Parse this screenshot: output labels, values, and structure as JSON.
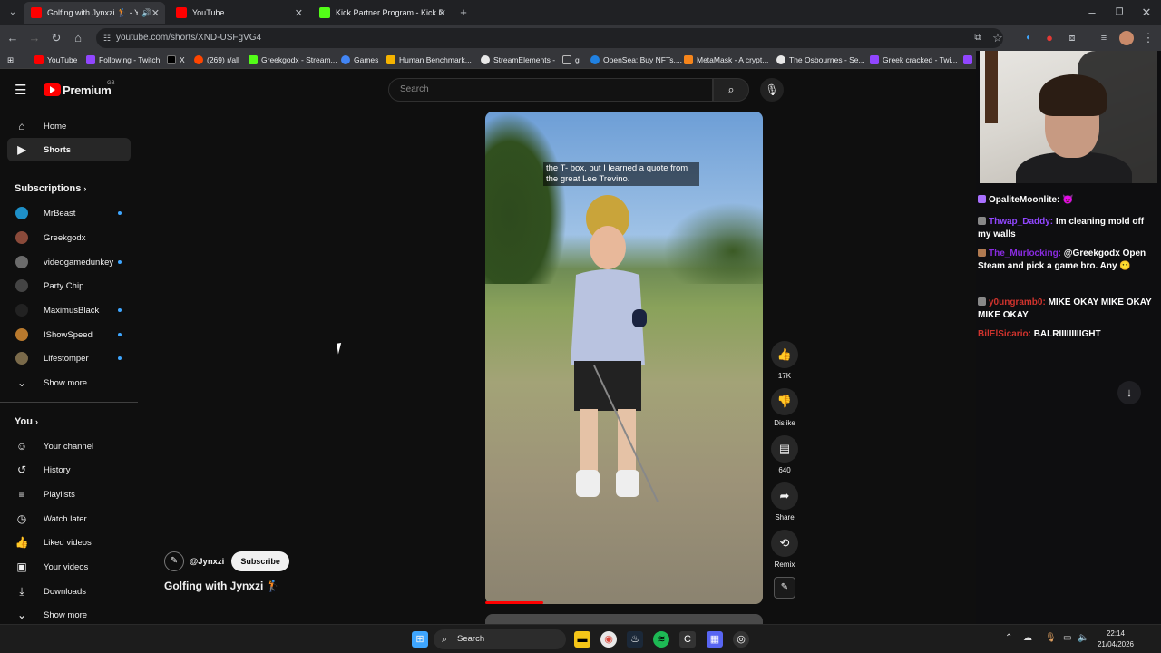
{
  "tabs": [
    {
      "title": "Golfing with Jynxzi 🏌 - Yo",
      "active": true,
      "icon": "youtube-icon"
    },
    {
      "title": "YouTube",
      "active": false,
      "icon": "youtube-icon"
    },
    {
      "title": "Kick Partner Program - Kick Da",
      "active": false,
      "icon": "kick-icon"
    }
  ],
  "browser": {
    "url": "youtube.com/shorts/XND-USFgVG4",
    "new_tab": "+",
    "bookmarks": [
      "YouTube",
      "Following - Twitch",
      "X",
      "(269) r/all",
      "Greekgodx - Stream...",
      "Games",
      "Human Benchmark...",
      "StreamElements -",
      "g",
      "OpenSea: Buy NFTs,...",
      "MetaMask - A crypt...",
      "The Osbournes - Se...",
      "Greek cracked - Twi...",
      "D"
    ]
  },
  "youtube": {
    "logo": "Premium",
    "logo_region": "GB",
    "search_placeholder": "Search",
    "nav": [
      {
        "label": "Home",
        "icon": "home-icon"
      },
      {
        "label": "Shorts",
        "icon": "shorts-icon",
        "active": true
      }
    ],
    "subscriptions_title": "Subscriptions",
    "subscriptions": [
      {
        "name": "MrBeast",
        "dot": true,
        "color": "#1e90c8"
      },
      {
        "name": "Greekgodx",
        "dot": false,
        "color": "#8a4a3a"
      },
      {
        "name": "videogamedunkey",
        "dot": true,
        "color": "#6b6b6b"
      },
      {
        "name": "Party Chip",
        "dot": false,
        "color": "#444444"
      },
      {
        "name": "MaximusBlack",
        "dot": true,
        "color": "#222222"
      },
      {
        "name": "IShowSpeed",
        "dot": true,
        "color": "#b8792d"
      },
      {
        "name": "Lifestomper",
        "dot": true,
        "color": "#7a6a4a"
      }
    ],
    "show_more": "Show more",
    "you_title": "You",
    "you_items": [
      {
        "label": "Your channel",
        "icon": "channel-icon"
      },
      {
        "label": "History",
        "icon": "history-icon"
      },
      {
        "label": "Playlists",
        "icon": "playlists-icon"
      },
      {
        "label": "Watch later",
        "icon": "watch-later-icon"
      },
      {
        "label": "Liked videos",
        "icon": "like-icon"
      },
      {
        "label": "Your videos",
        "icon": "your-videos-icon"
      },
      {
        "label": "Downloads",
        "icon": "download-icon"
      }
    ],
    "short": {
      "caption": "the T- box, but I learned a quote from the great Lee Trevino.",
      "channel_handle": "@Jynxzi",
      "subscribe_label": "Subscribe",
      "title": "Golfing with Jynxzi 🏌",
      "progress": 0.21,
      "actions": [
        {
          "icon": "like-icon",
          "label": "17K"
        },
        {
          "icon": "dislike-icon",
          "label": "Dislike"
        },
        {
          "icon": "comment-icon",
          "label": "640"
        },
        {
          "icon": "share-icon",
          "label": "Share"
        },
        {
          "icon": "remix-icon",
          "label": "Remix"
        }
      ]
    }
  },
  "chat": [
    {
      "user": "OpaliteMoonlite:",
      "text": "",
      "color": "#f1f1f1",
      "badge": "#a970ff"
    },
    {
      "user": "Thwap_Daddy:",
      "text": "Im cleaning mold off my walls",
      "color": "#9147ff",
      "badge": "#888888"
    },
    {
      "user": "The_Murlocking:",
      "text": "@Greekgodx Open Steam and pick a game bro. Any",
      "color": "#8a2be2",
      "badge": "#b07a50"
    },
    {
      "user": "y0ungramb0:",
      "text": "MIKE OKAY MIKE OKAY MIKE OKAY",
      "color": "#d0332d",
      "badge": "#888888"
    },
    {
      "user": "BilElSicario:",
      "text": "BALRIIIIIIIIIGHT",
      "color": "#d0332d",
      "badge": ""
    }
  ],
  "taskbar": {
    "search": "Search",
    "time": "22:14",
    "date": "21/04/2026"
  }
}
